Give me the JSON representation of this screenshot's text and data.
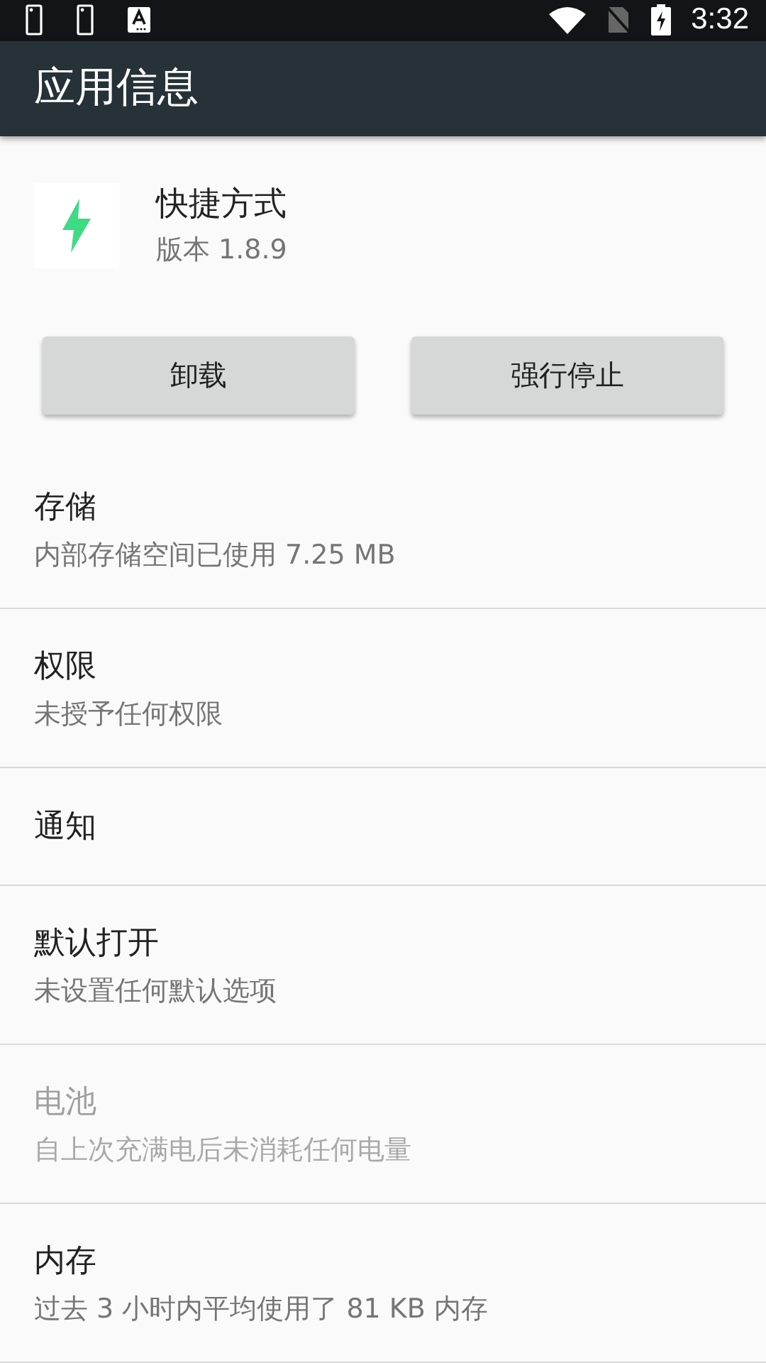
{
  "status_bar": {
    "time": "3:32"
  },
  "app_bar": {
    "title": "应用信息"
  },
  "app": {
    "name": "快捷方式",
    "version": "版本 1.8.9"
  },
  "buttons": [
    {
      "label": "卸载",
      "disabled": false
    },
    {
      "label": "强行停止",
      "disabled": false
    }
  ],
  "items": [
    {
      "title": "存储",
      "summary": "内部存储空间已使用 7.25 MB",
      "disabled": false
    },
    {
      "title": "权限",
      "summary": "未授予任何权限",
      "disabled": false
    },
    {
      "title": "通知",
      "disabled": false
    },
    {
      "title": "默认打开",
      "summary": "未设置任何默认选项",
      "disabled": false
    },
    {
      "title": "电池",
      "summary": "自上次充满电后未消耗任何电量",
      "disabled": true
    },
    {
      "title": "内存",
      "summary": "过去 3 小时内平均使用了 81 KB 内存",
      "disabled": false
    }
  ]
}
